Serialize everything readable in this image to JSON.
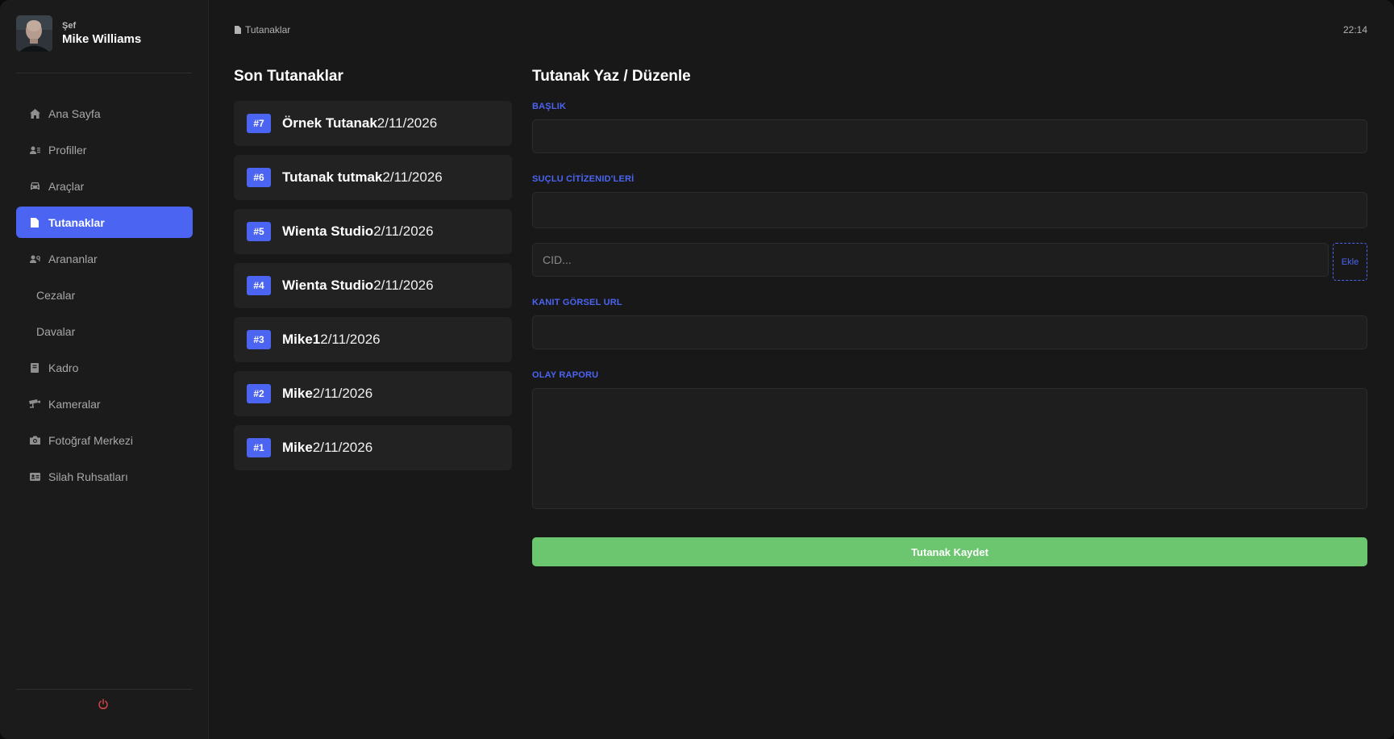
{
  "user": {
    "role": "Şef",
    "name": "Mike Williams"
  },
  "sidebar": {
    "items": [
      {
        "label": "Ana Sayfa",
        "icon": "home-icon"
      },
      {
        "label": "Profiller",
        "icon": "users-icon"
      },
      {
        "label": "Araçlar",
        "icon": "car-icon"
      },
      {
        "label": "Tutanaklar",
        "icon": "file-icon",
        "active": true
      },
      {
        "label": "Arananlar",
        "icon": "user-search-icon"
      },
      {
        "label": "Cezalar",
        "icon": ""
      },
      {
        "label": "Davalar",
        "icon": ""
      },
      {
        "label": "Kadro",
        "icon": "book-icon"
      },
      {
        "label": "Kameralar",
        "icon": "camera-cctv-icon"
      },
      {
        "label": "Fotoğraf Merkezi",
        "icon": "camera-icon"
      },
      {
        "label": "Silah Ruhsatları",
        "icon": "id-card-icon"
      }
    ],
    "logout_icon": "power-icon"
  },
  "header": {
    "breadcrumb": "Tutanaklar",
    "time": "22:14"
  },
  "records_list": {
    "title": "Son Tutanaklar",
    "items": [
      {
        "badge": "#7",
        "title": "Örnek Tutanak",
        "date": "2/11/2026"
      },
      {
        "badge": "#6",
        "title": "Tutanak tutmak",
        "date": "2/11/2026"
      },
      {
        "badge": "#5",
        "title": "Wienta Studio",
        "date": "2/11/2026"
      },
      {
        "badge": "#4",
        "title": "Wienta Studio",
        "date": "2/11/2026"
      },
      {
        "badge": "#3",
        "title": "Mike1",
        "date": "2/11/2026"
      },
      {
        "badge": "#2",
        "title": "Mike",
        "date": "2/11/2026"
      },
      {
        "badge": "#1",
        "title": "Mike",
        "date": "2/11/2026"
      }
    ]
  },
  "form": {
    "title": "Tutanak Yaz / Düzenle",
    "title_label": "BAŞLIK",
    "title_value": "",
    "suspects_label": "SUÇLU CİTİZENID'LERİ",
    "suspects_value": "",
    "cid_placeholder": "CID...",
    "cid_value": "",
    "add_label": "Ekle",
    "evidence_label": "KANIT GÖRSEL URL",
    "evidence_value": "",
    "report_label": "OLAY RAPORU",
    "report_value": "",
    "save_label": "Tutanak Kaydet"
  },
  "colors": {
    "accent": "#4b64f2",
    "success": "#6cc66f",
    "danger": "#e04646",
    "background": "#181818",
    "panel": "#222222"
  }
}
